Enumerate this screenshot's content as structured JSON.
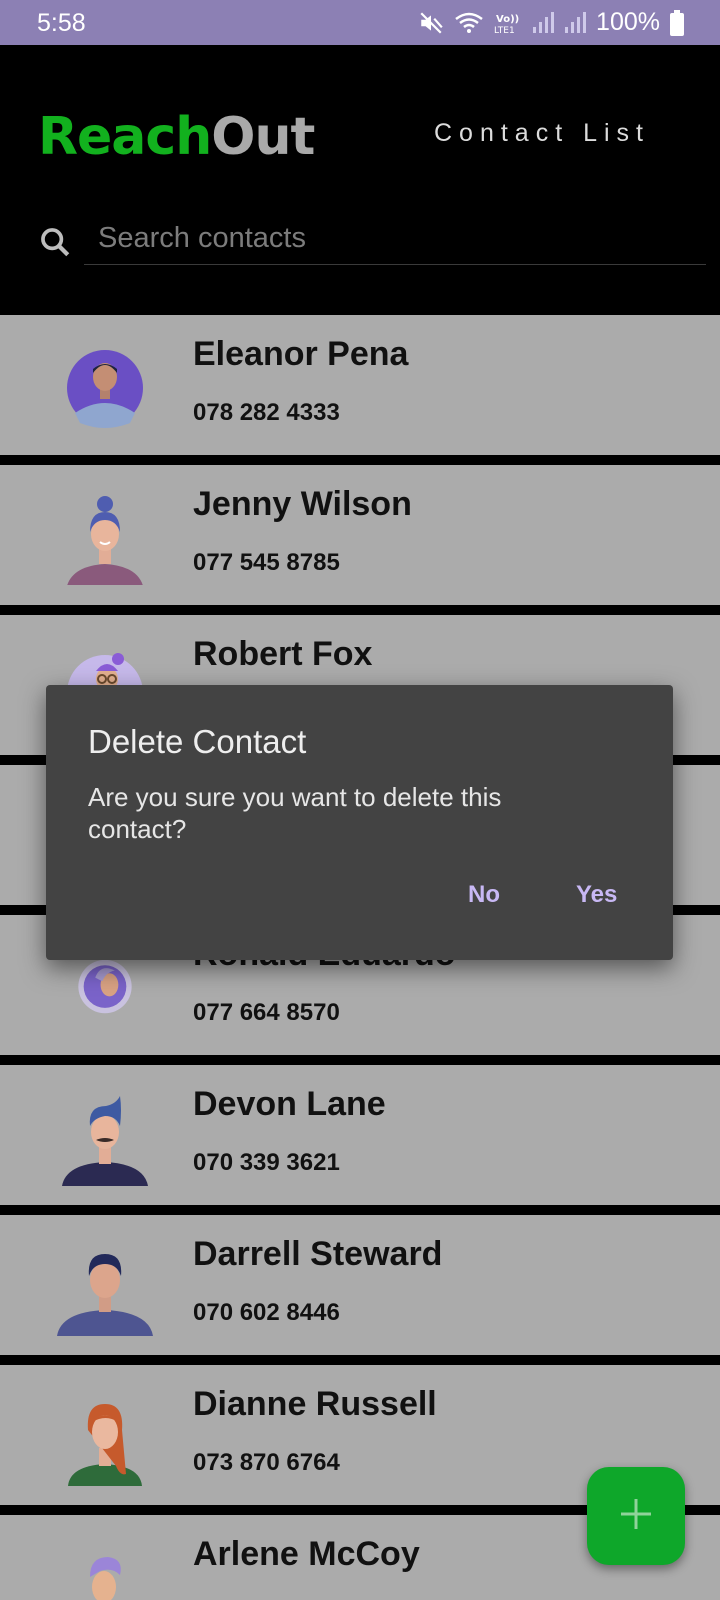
{
  "status_bar": {
    "time": "5:58",
    "battery": "100%"
  },
  "header": {
    "logo_part1": "Reach",
    "logo_part2": "Out",
    "title": "Contact List",
    "search_placeholder": "Search contacts"
  },
  "contacts": [
    {
      "name": "Eleanor Pena",
      "phone": "078 282 4333"
    },
    {
      "name": "Jenny Wilson",
      "phone": "077 545 8785"
    },
    {
      "name": "Robert Fox",
      "phone": ""
    },
    {
      "name": "",
      "phone": ""
    },
    {
      "name": "Ronald Eduardo",
      "phone": "077 664 8570"
    },
    {
      "name": "Devon Lane",
      "phone": "070 339 3621"
    },
    {
      "name": "Darrell Steward",
      "phone": "070 602 8446"
    },
    {
      "name": "Dianne Russell",
      "phone": "073 870 6764"
    },
    {
      "name": "Arlene McCoy",
      "phone": ""
    }
  ],
  "dialog": {
    "title": "Delete Contact",
    "message": "Are you sure you want to delete this contact?",
    "no_label": "No",
    "yes_label": "Yes"
  },
  "colors": {
    "status_bar": "#8c80b4",
    "logo_green": "#12b11e",
    "logo_gray": "#a9a9a9",
    "row_bg": "#ababab",
    "dialog_bg": "#434343",
    "dialog_button": "#c8b8f4",
    "fab": "#0ea72a"
  },
  "icons": {
    "search": "search-icon",
    "fab": "plus-icon",
    "status": [
      "mute-icon",
      "wifi-icon",
      "volte-icon",
      "signal-icon",
      "signal-icon",
      "battery-icon"
    ]
  }
}
